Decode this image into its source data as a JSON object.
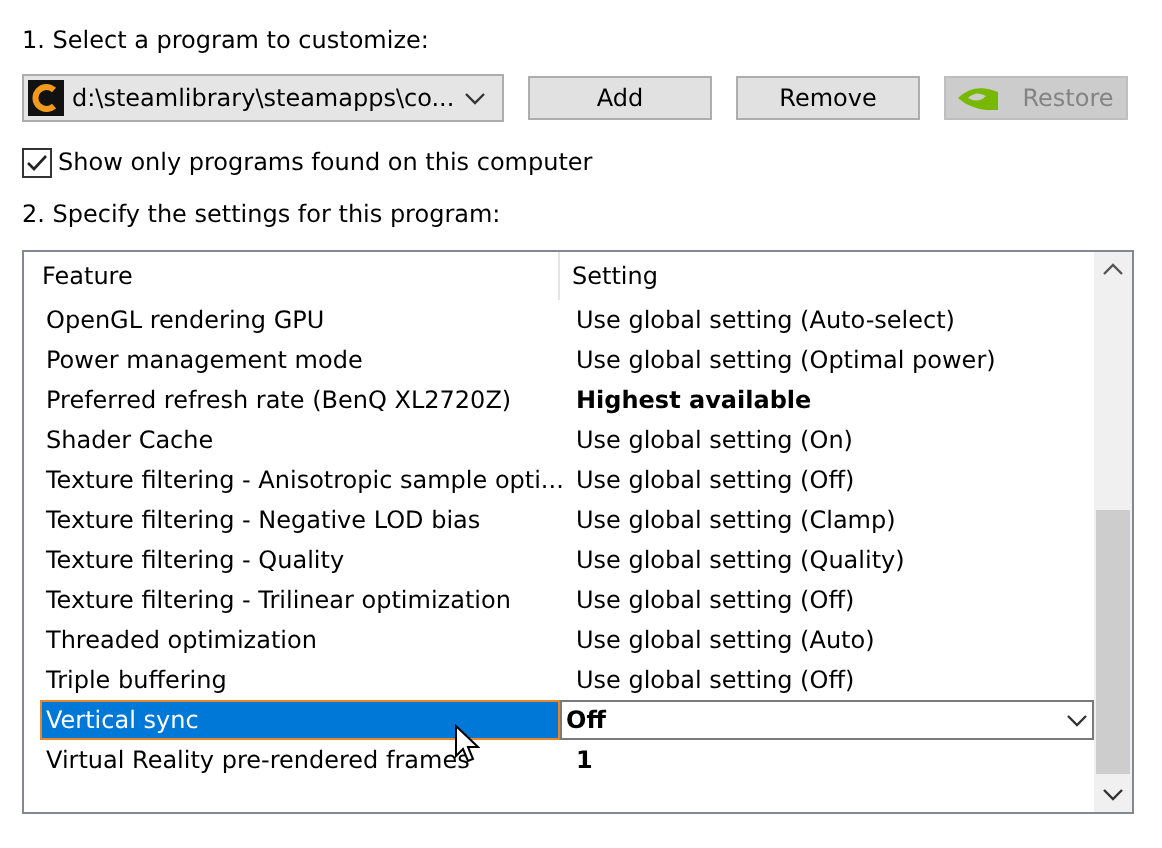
{
  "step1_label": "1. Select a program to customize:",
  "program_select": {
    "value": "d:\\steamlibrary\\steamapps\\co..."
  },
  "buttons": [
    {
      "label": "Add",
      "disabled": false
    },
    {
      "label": "Remove",
      "disabled": false
    },
    {
      "label": "Restore",
      "disabled": true
    }
  ],
  "show_only_found": {
    "label": "Show only programs found on this computer",
    "checked": true
  },
  "step2_label": "2. Specify the settings for this program:",
  "table": {
    "columns": [
      "Feature",
      "Setting"
    ],
    "rows": [
      {
        "feature": "OpenGL rendering GPU",
        "setting": "Use global setting (Auto-select)",
        "bold": false,
        "selected": false
      },
      {
        "feature": "Power management mode",
        "setting": "Use global setting (Optimal power)",
        "bold": false,
        "selected": false
      },
      {
        "feature": "Preferred refresh rate (BenQ XL2720Z)",
        "setting": "Highest available",
        "bold": true,
        "selected": false
      },
      {
        "feature": "Shader Cache",
        "setting": "Use global setting (On)",
        "bold": false,
        "selected": false
      },
      {
        "feature": "Texture filtering - Anisotropic sample opti...",
        "setting": "Use global setting (Off)",
        "bold": false,
        "selected": false
      },
      {
        "feature": "Texture filtering - Negative LOD bias",
        "setting": "Use global setting (Clamp)",
        "bold": false,
        "selected": false
      },
      {
        "feature": "Texture filtering - Quality",
        "setting": "Use global setting (Quality)",
        "bold": false,
        "selected": false
      },
      {
        "feature": "Texture filtering - Trilinear optimization",
        "setting": "Use global setting (Off)",
        "bold": false,
        "selected": false
      },
      {
        "feature": "Threaded optimization",
        "setting": "Use global setting (Auto)",
        "bold": false,
        "selected": false
      },
      {
        "feature": "Triple buffering",
        "setting": "Use global setting (Off)",
        "bold": false,
        "selected": false
      },
      {
        "feature": "Vertical sync",
        "setting": "Off",
        "bold": true,
        "selected": true
      },
      {
        "feature": "Virtual Reality pre-rendered frames",
        "setting": "1",
        "bold": true,
        "selected": false
      }
    ]
  }
}
